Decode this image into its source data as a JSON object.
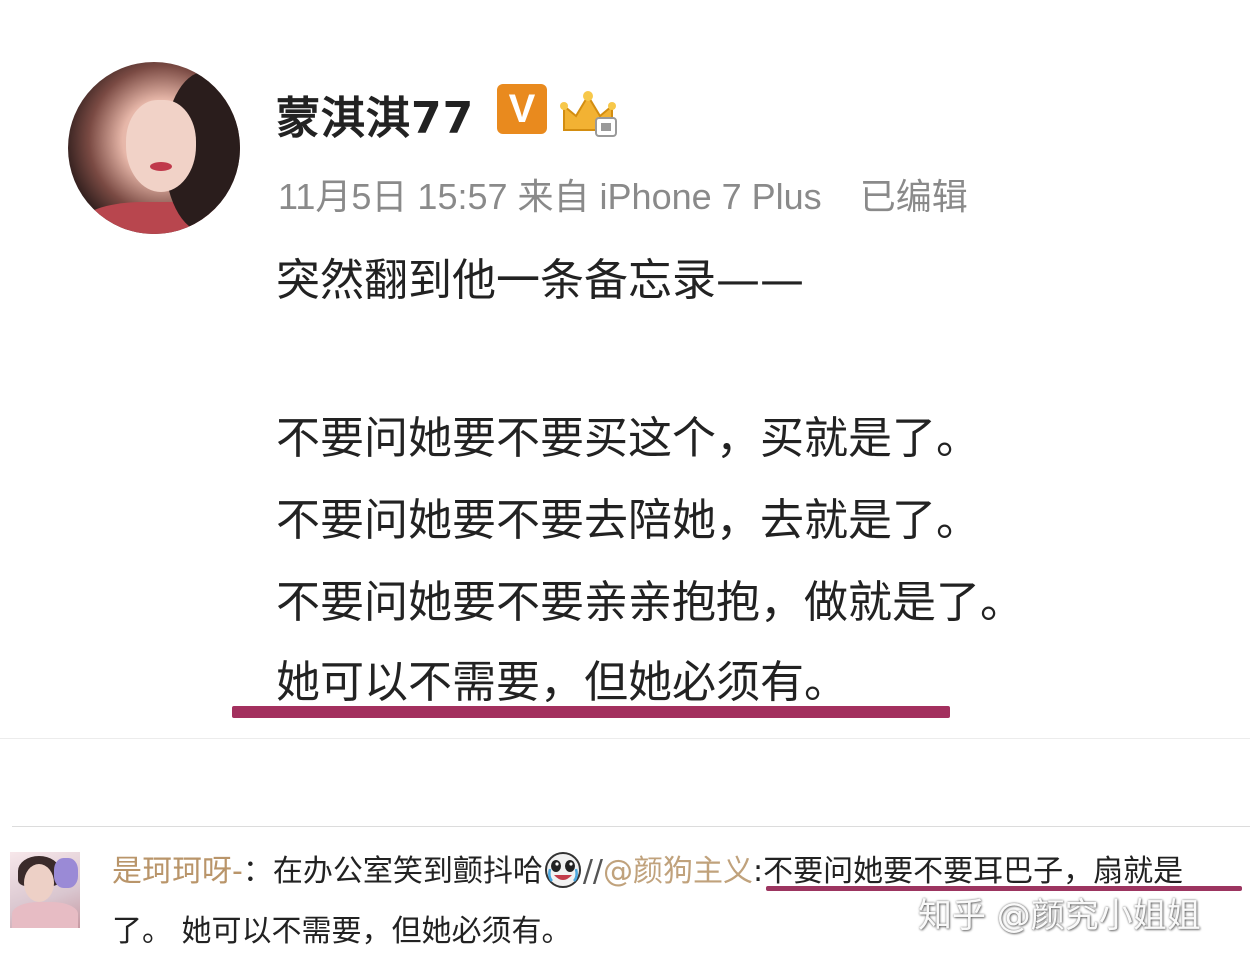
{
  "post": {
    "username": "蒙淇淇77",
    "verified_badge": "V",
    "member_icon": "crown-icon",
    "meta": {
      "date": "11月5日",
      "time": "15:57",
      "source": "来自 iPhone 7 Plus",
      "edited": "已编辑"
    },
    "lines": [
      "突然翻到他一条备忘录——",
      "不要问她要不要买这个，买就是了。",
      "不要问她要不要去陪她，去就是了。",
      "不要问她要不要亲亲抱抱，做就是了。",
      "她可以不需要，但她必须有。"
    ],
    "highlight_color": "#a3305e"
  },
  "comment": {
    "user": "是珂珂呀-",
    "colon": "：",
    "text": "在办公室笑到颤抖哈",
    "emoji": "laughing-crying-emoji",
    "repost_sep": "//",
    "mention": "@颜狗主义",
    "quote_colon": ":",
    "quote": "不要问她要不要耳巴子，扇就是",
    "line2": "了。 她可以不需要，但她必须有。"
  },
  "watermark": "知乎 @颜究小姐姐"
}
